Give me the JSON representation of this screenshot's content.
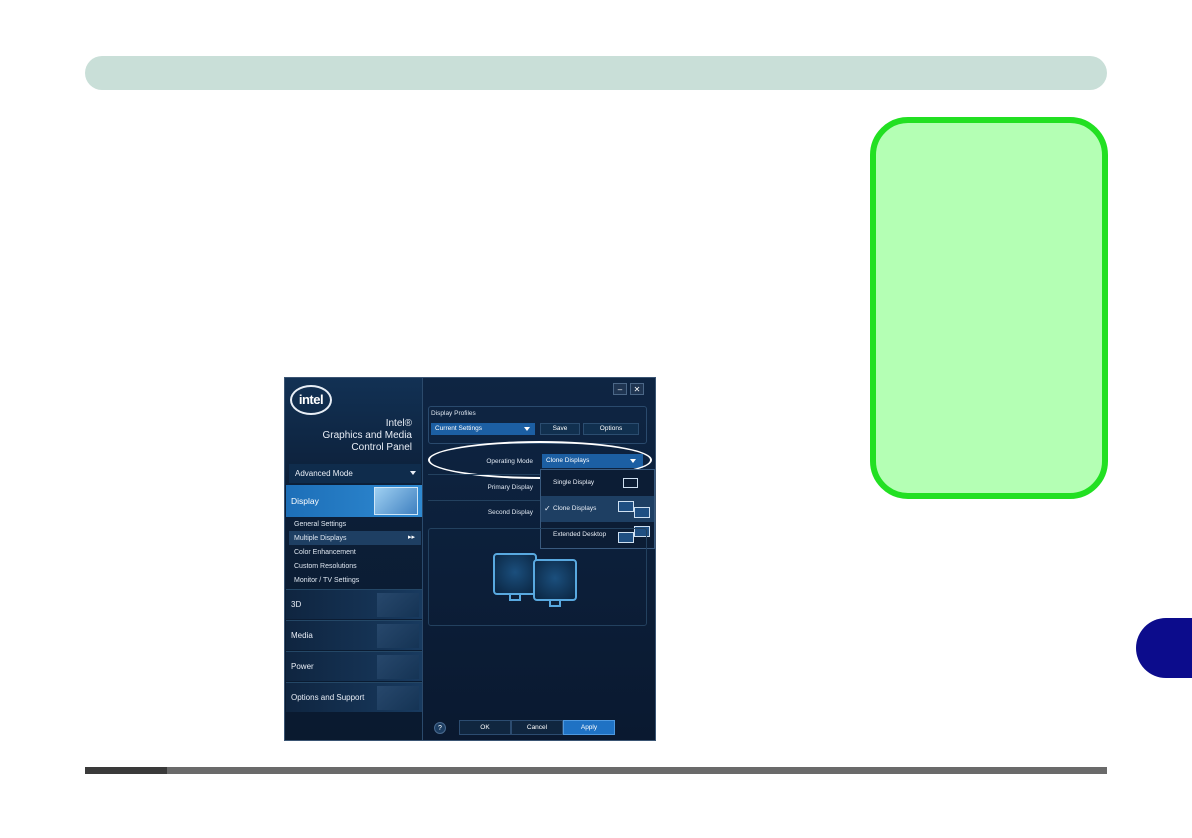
{
  "window": {
    "logo_text": "intel",
    "title_lines": [
      "Intel®",
      "Graphics and Media",
      "Control Panel"
    ],
    "minimize_label": "–",
    "close_label": "✕"
  },
  "sidebar": {
    "mode_label": "Advanced Mode",
    "selected_category": "Display",
    "sub_items": [
      "General Settings",
      "Multiple Displays",
      "Color Enhancement",
      "Custom Resolutions",
      "Monitor / TV Settings"
    ],
    "selected_sub_item_marker": "▸▸",
    "categories": [
      "3D",
      "Media",
      "Power",
      "Options and Support"
    ]
  },
  "main": {
    "profiles_label": "Display Profiles",
    "current_profile": "Current Settings",
    "save_label": "Save",
    "options_label": "Options",
    "operating_mode_label": "Operating Mode",
    "operating_mode_value": "Clone Displays",
    "primary_display_label": "Primary Display",
    "second_display_label": "Second Display",
    "mode_options": [
      "Single Display",
      "Clone Displays",
      "Extended Desktop"
    ],
    "selected_mode_check": "✓"
  },
  "footer": {
    "help_label": "?",
    "ok_label": "OK",
    "cancel_label": "Cancel",
    "apply_label": "Apply"
  },
  "colors": {
    "header_bar": "#c9dfd8",
    "callout_fill": "#b4ffb4",
    "callout_border": "#22e022",
    "section_tab": "#0c0c8c",
    "window_bg": "#0b1c33",
    "accent_blue": "#1f72c4"
  }
}
